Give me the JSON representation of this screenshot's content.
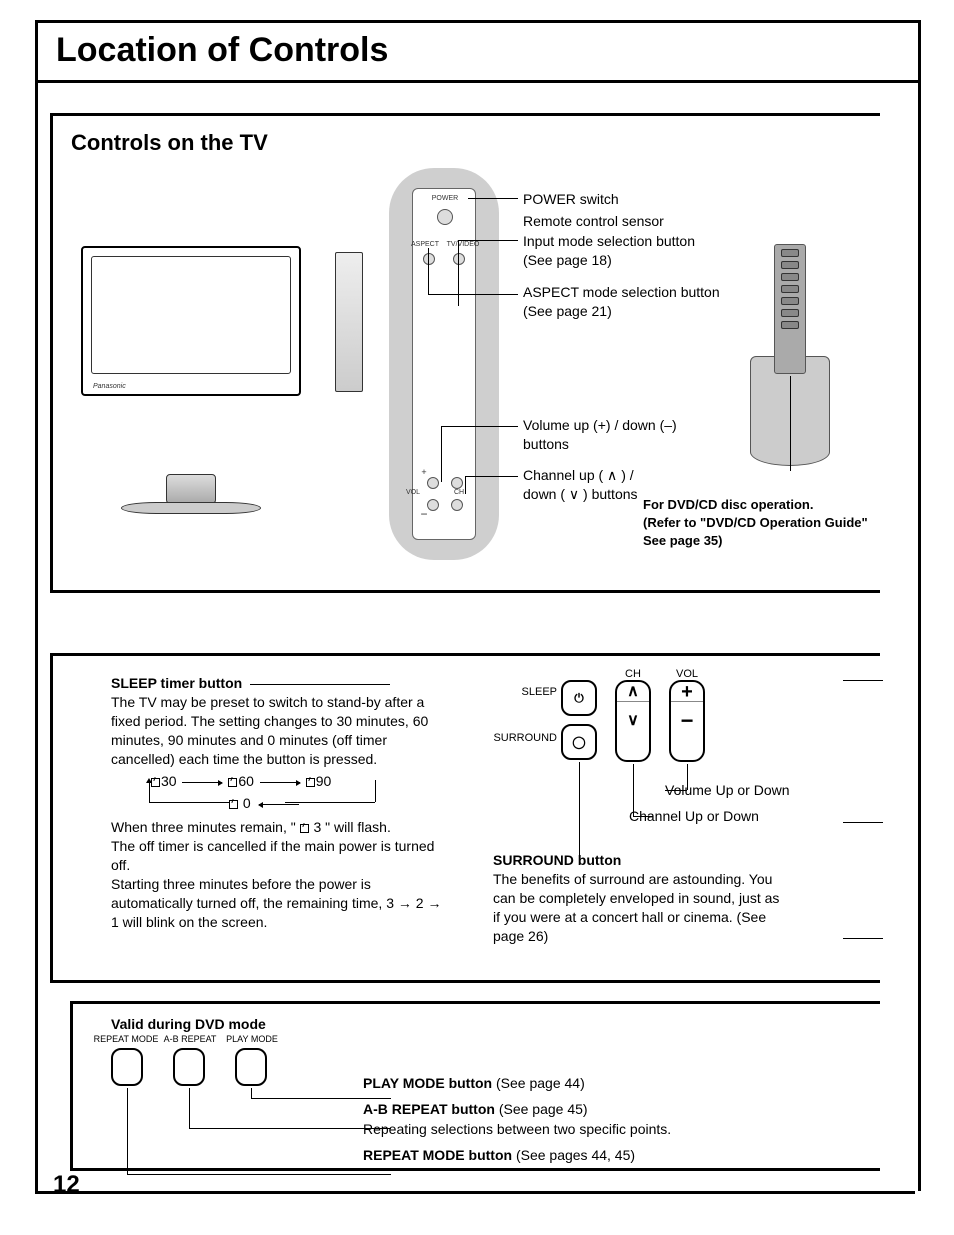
{
  "page": {
    "title": "Location of Controls",
    "number": "12"
  },
  "tv_section": {
    "heading": "Controls on the TV",
    "panel_labels": {
      "power": "POWER",
      "aspect": "ASPECT",
      "tvvideo": "TV/VIDEO",
      "vol": "VOL",
      "ch": "CH"
    },
    "callouts": {
      "power": "POWER switch",
      "remote_sensor": "Remote control sensor",
      "input_mode": "Input mode selection button\n(See page 18)",
      "aspect_mode": "ASPECT mode selection button\n(See page 21)",
      "volume": "Volume up (+) / down (–)\nbuttons",
      "channel": "Channel up ( ∧ ) /\ndown ( ∨ ) buttons"
    },
    "dvd_note": "For DVD/CD disc operation.\n(Refer to \"DVD/CD Operation Guide\" See page 35)"
  },
  "remote_section": {
    "sleep": {
      "heading": "SLEEP timer button",
      "body1": "The TV may be preset to switch to stand-by after a fixed period. The setting changes to 30 minutes, 60 minutes, 90 minutes and 0 minutes (off timer cancelled) each time the button is pressed.",
      "values": {
        "a": "30",
        "b": "60",
        "c": "90",
        "d": "0"
      },
      "body2": "When three minutes remain, \"    3  \" will flash.",
      "body2_icon_note": "",
      "body3": "The off timer is cancelled if the main power is turned off.",
      "body4": "Starting three minutes before the power is automatically turned off, the remaining time, 3 → 2 → 1 will blink on the screen."
    },
    "buttons": {
      "sleep_label": "SLEEP",
      "surround_label": "SURROUND",
      "ch_label": "CH",
      "vol_label": "VOL",
      "vol_text": "Volume Up or Down",
      "ch_text": "Channel Up or Down"
    },
    "surround": {
      "heading": "SURROUND button",
      "body": "The benefits of surround are astounding. You can be completely enveloped in sound, just as if you were at a concert hall or cinema. (See page 26)"
    }
  },
  "dvd_section": {
    "heading": "Valid during DVD mode",
    "labels": {
      "repeat_mode": "REPEAT MODE",
      "ab_repeat": "A-B REPEAT",
      "play_mode": "PLAY MODE"
    },
    "callouts": {
      "play_mode": {
        "bold": "PLAY MODE button",
        "rest": " (See page 44)"
      },
      "ab_repeat": {
        "bold": "A-B REPEAT button",
        "rest": " (See page 45)",
        "line2": "Repeating selections between two specific points."
      },
      "repeat_mode": {
        "bold": "REPEAT MODE button",
        "rest": " (See pages 44, 45)"
      }
    }
  }
}
